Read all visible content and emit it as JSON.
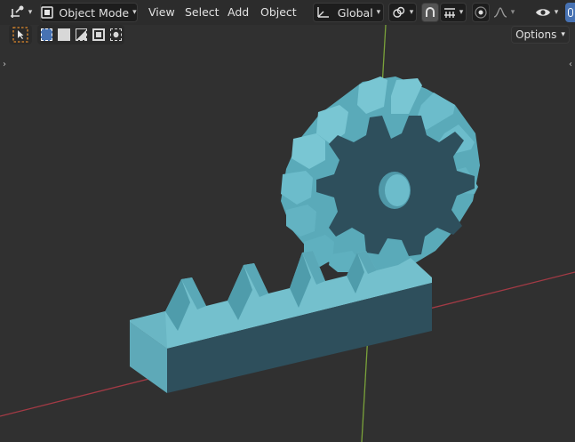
{
  "header": {
    "editor_type_icon": "transform-gizmo-icon",
    "mode": {
      "label": "Object Mode",
      "icon": "object-mode-icon"
    },
    "menus": [
      "View",
      "Select",
      "Add",
      "Object"
    ],
    "transform_orientation": {
      "label": "Global",
      "icon": "orientation-axes-icon"
    },
    "pivot_icon": "pivot-link-icon",
    "snap_icon": "magnet-snap-icon",
    "snap_target_icon": "snap-increment-icon",
    "proportional_icon": "proportional-edit-icon",
    "falloff_icon": "falloff-curve-icon",
    "visibility_icon": "eye-visibility-icon"
  },
  "toolbar": {
    "select_tool_icon": "select-box-cursor-icon",
    "select_modes": [
      "select-new-icon",
      "select-extend-icon",
      "select-subtract-icon",
      "select-invert-icon",
      "select-intersect-icon"
    ],
    "options_label": "Options"
  },
  "colors": {
    "background": "#303030",
    "header": "#2c2c2c",
    "gear_light": "#6bbac8",
    "gear_dark": "#2f4f5c",
    "x_axis": "#a33a45",
    "y_axis": "#7aa23a",
    "accent": "#4772b3"
  }
}
